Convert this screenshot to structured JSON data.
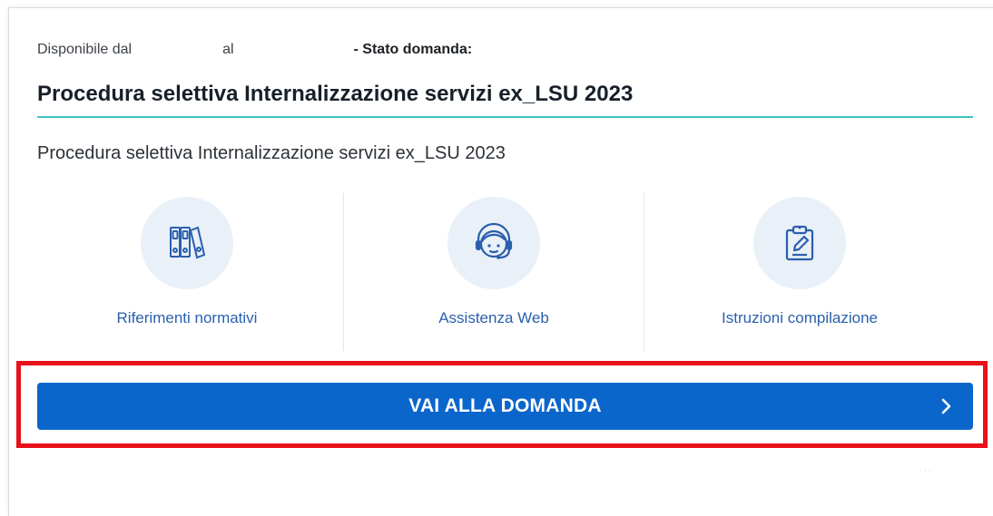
{
  "meta": {
    "available_label": "Disponibile dal",
    "to_label": "al",
    "status_label": "- Stato domanda:"
  },
  "title": "Procedura selettiva Internalizzazione servizi ex_LSU 2023",
  "description": "Procedura selettiva Internalizzazione servizi ex_LSU 2023",
  "links": [
    {
      "label": "Riferimenti normativi",
      "icon": "binders-icon"
    },
    {
      "label": "Assistenza Web",
      "icon": "headset-agent-icon"
    },
    {
      "label": "Istruzioni compilazione",
      "icon": "clipboard-edit-icon"
    }
  ],
  "cta": {
    "label": "VAI ALLA DOMANDA",
    "icon": "chevron-right-icon"
  },
  "faint_text": "· ·",
  "colors": {
    "accent_blue": "#0b66cb",
    "link_blue": "#2a5fad",
    "teal_rule": "#3ec4c4",
    "highlight_red": "#e8101a",
    "icon_circle": "#e9f0f8"
  }
}
